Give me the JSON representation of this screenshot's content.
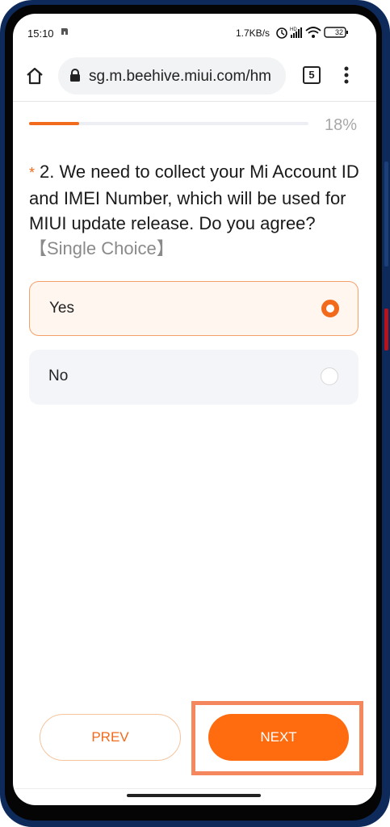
{
  "status_bar": {
    "time": "15:10",
    "network_speed": "1.7KB/s",
    "battery": "32"
  },
  "browser": {
    "url": "sg.m.beehive.miui.com/hm",
    "tab_count": "5"
  },
  "survey": {
    "progress_percent": 18,
    "progress_label": "18%",
    "required_marker": "*",
    "question_text": "2. We need to collect your Mi Account ID and IMEI Number, which will be used for MIUI update release. Do you agree?",
    "choice_type": "【Single Choice】",
    "options": [
      {
        "label": "Yes",
        "selected": true
      },
      {
        "label": "No",
        "selected": false
      }
    ]
  },
  "nav": {
    "prev_label": "PREV",
    "next_label": "NEXT"
  },
  "colors": {
    "accent": "#ff6b0f",
    "selected_bg": "#fff6f0"
  },
  "icons": [
    "home-icon",
    "lock-icon",
    "tabs-icon",
    "more-vert-icon",
    "alarm-icon",
    "signal-icon",
    "wifi-icon",
    "battery-icon"
  ]
}
